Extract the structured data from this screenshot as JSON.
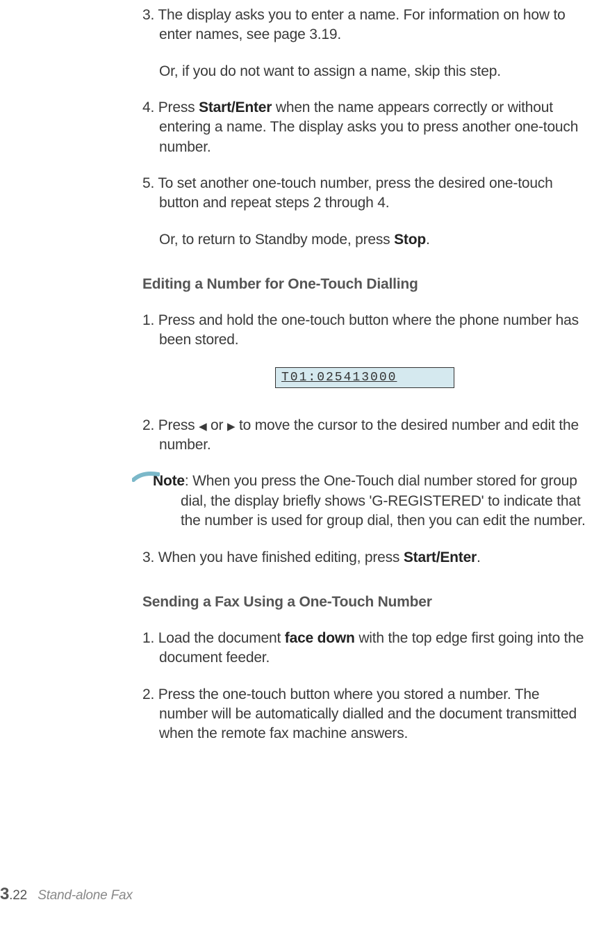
{
  "s3_num": "3. ",
  "s3": "The display asks you to enter a name. For information on how to enter names, see page 3.19.",
  "s3_or": "Or, if you do not want to assign a name, skip this step.",
  "s4_num": "4. ",
  "s4_a": "Press ",
  "s4_bold": "Start/Enter",
  "s4_b": " when the name appears correctly or without entering a name. The display asks you to press another one-touch number.",
  "s5_num": "5. ",
  "s5": "To set another one-touch number, press the desired one-touch button and repeat steps 2 through 4.",
  "s5_or_a": "Or, to return to Standby mode, press ",
  "s5_or_bold": "Stop",
  "s5_or_b": ".",
  "h_edit": "Editing a Number for One-Touch Dialling",
  "e1_num": "1. ",
  "e1": "Press and hold the one-touch button where the phone number has been stored.",
  "display": "T01:025413000",
  "e2_num": "2. ",
  "e2_a": "Press ",
  "e2_tri_l": "◀",
  "e2_mid": " or ",
  "e2_tri_r": "▶",
  "e2_b": " to move the cursor to the desired number and edit the number.",
  "note_label": "Note",
  "note_colon": ": ",
  "note": "When you press the One-Touch dial number stored for group dial, the display briefly shows 'G-REGISTERED' to indicate that the number is used for group dial, then you can edit the number.",
  "e3_num": "3. ",
  "e3_a": "When you have finished editing, press ",
  "e3_bold": "Start/Enter",
  "e3_b": ".",
  "h_send": "Sending a Fax Using a One-Touch Number",
  "f1_num": "1. ",
  "f1_a": "Load the document ",
  "f1_bold": "face down",
  "f1_b": " with the top edge first going into the document feeder.",
  "f2_num": "2. ",
  "f2": "Press the one-touch button where you stored a number. The number will be automatically dialled and the document transmitted when the remote fax machine answers.",
  "page_chapter": "3",
  "page_dot": ".",
  "page_num": "22",
  "page_title": "Stand-alone Fax"
}
